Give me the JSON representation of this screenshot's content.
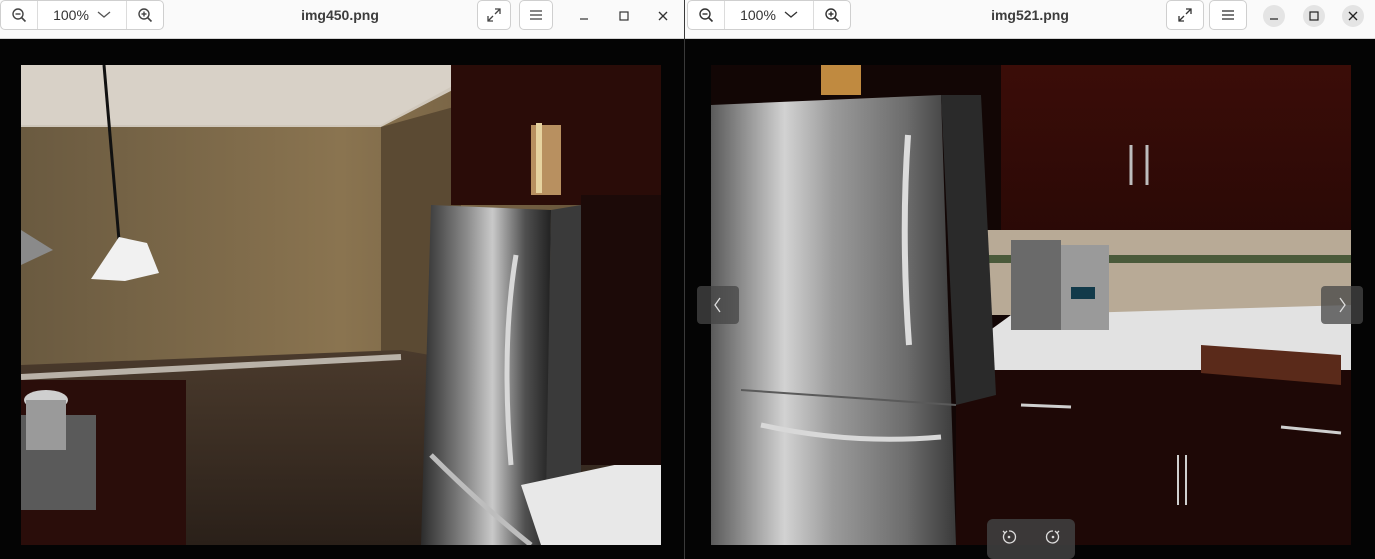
{
  "windows": [
    {
      "title": "img450.png",
      "zoom_value": "100%",
      "icons": [
        "zoom-out-icon",
        "chevron-down-icon",
        "zoom-in-icon",
        "fullscreen-icon",
        "menu-icon",
        "minimize-icon",
        "maximize-icon",
        "close-icon"
      ],
      "scene": "kitchen render with pendant lamp and stainless refrigerator"
    },
    {
      "title": "img521.png",
      "zoom_value": "100%",
      "icons": [
        "zoom-out-icon",
        "chevron-down-icon",
        "zoom-in-icon",
        "fullscreen-icon",
        "menu-icon",
        "minimize-icon",
        "maximize-icon",
        "close-icon",
        "previous-icon",
        "next-icon",
        "rotate-left-icon",
        "rotate-right-icon"
      ],
      "scene": "kitchen render with stainless refrigerator, cabinets and coffee maker"
    }
  ],
  "colors": {
    "titlebar_bg": "#fafafa",
    "viewer_bg": "#040404",
    "title_text": "#3d3d3d"
  }
}
